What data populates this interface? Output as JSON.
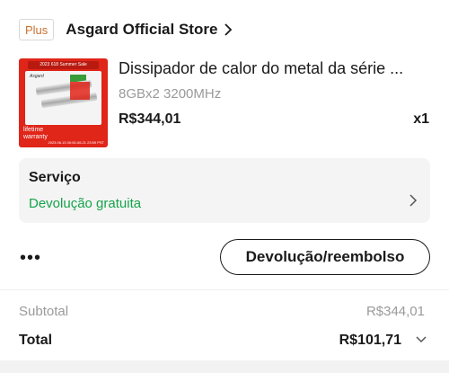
{
  "store": {
    "badge": "Plus",
    "name": "Asgard Official Store"
  },
  "product": {
    "image": {
      "banner": "2023 618 Summer Sale",
      "brand": "Asgard",
      "warranty_line1": "lifetime",
      "warranty_line2": "warranty",
      "footer": "2023.06.13 00:00-06.21 23:59 PST"
    },
    "title": "Dissipador de calor do metal da série ...",
    "variant": "8GBx2 3200MHz",
    "price": "R$344,01",
    "quantity": "x1"
  },
  "service": {
    "title": "Serviço",
    "subtitle": "Devolução gratuita",
    "accent_color": "#16a34a"
  },
  "actions": {
    "more_label": "•••",
    "refund_label": "Devolução/reembolso"
  },
  "summary": {
    "subtotal_label": "Subtotal",
    "subtotal_value": "R$344,01",
    "total_label": "Total",
    "total_value": "R$101,71"
  }
}
